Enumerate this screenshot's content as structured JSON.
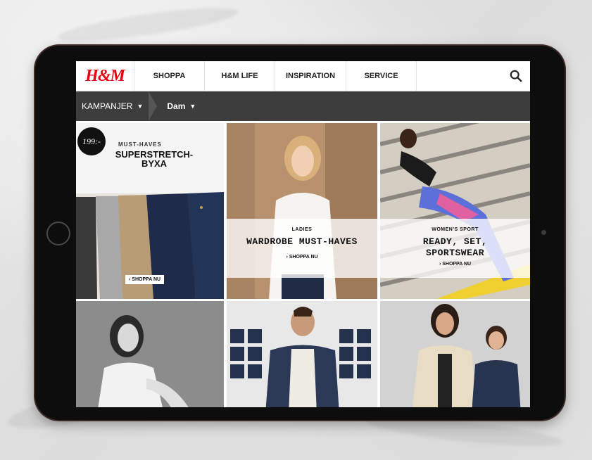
{
  "nav": {
    "logo": "H&M",
    "items": [
      "SHOPPA",
      "H&M LIFE",
      "INSPIRATION",
      "SERVICE"
    ],
    "search_icon": "search-icon"
  },
  "subnav": {
    "crumb1": "KAMPANJER",
    "crumb2": "Dam"
  },
  "tiles": {
    "t1": {
      "price": "199:-",
      "sub": "MUST-HAVES",
      "title_line1": "SUPERSTRETCH-",
      "title_line2": "BYXA",
      "button": "› SHOPPA NU"
    },
    "t2": {
      "sub": "LADIES",
      "title": "WARDROBE MUST-HAVES",
      "link": "› SHOPPA NU"
    },
    "t3": {
      "sub": "WOMEN'S SPORT",
      "title_line1": "READY, SET,",
      "title_line2": "SPORTSWEAR",
      "link": "› SHOPPA NU"
    }
  },
  "colors": {
    "brand_red": "#e50010",
    "subnav_bg": "#3d3d3d",
    "tablet_body": "#0d0d0d"
  }
}
